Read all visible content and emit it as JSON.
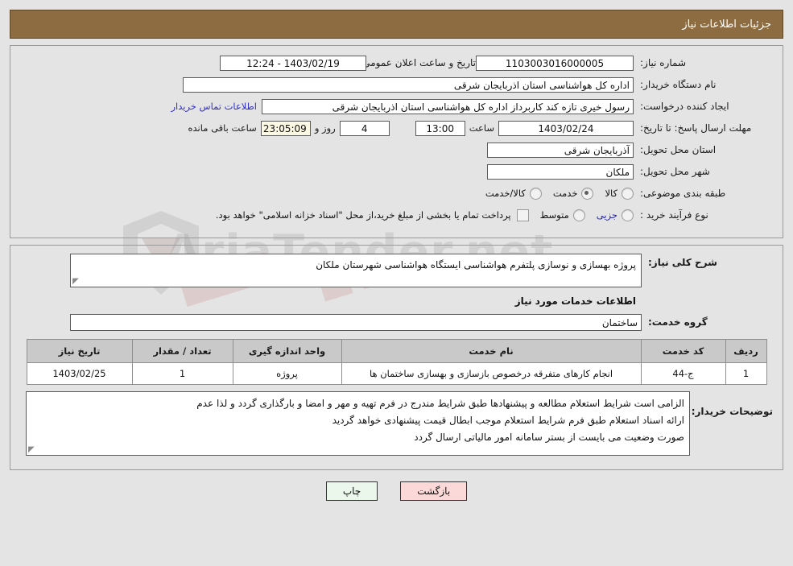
{
  "header": {
    "title": "جزئیات اطلاعات نیاز"
  },
  "colors": {
    "header_bg": "#8d6c42",
    "header_text": "#ffffff",
    "link": "#3030c8",
    "page_bg": "#e4e4e4",
    "table_header_bg": "#c9c9c9",
    "highlight_field_bg": "#fbf8e3",
    "print_btn_bg": "#eaf7ea",
    "back_btn_bg": "#fbd9d9"
  },
  "watermark": {
    "text": "AriaTender.net"
  },
  "form": {
    "need_number": {
      "label": "شماره نیاز:",
      "value": "1103003016000005"
    },
    "announce_datetime": {
      "label": "تاریخ و ساعت اعلان عمومی:",
      "value": "1403/02/19 - 12:24"
    },
    "buyer_org": {
      "label": "نام دستگاه خریدار:",
      "value": "اداره کل هواشناسی استان اذربایجان شرقی"
    },
    "buyer_org_second": {
      "value": ""
    },
    "requester": {
      "label": "ایجاد کننده درخواست:",
      "value": "رسول خیری تازه کند کاربرداز اداره کل هواشناسی استان اذربایجان شرقی"
    },
    "buyer_contact_link": {
      "label": "اطلاعات تماس خریدار"
    },
    "deadline": {
      "label": "مهلت ارسال پاسخ: تا تاریخ:",
      "date": "1403/02/24",
      "time_label": "ساعت",
      "time": "13:00",
      "days": "4",
      "days_label": "روز و",
      "countdown": "23:05:09",
      "countdown_label": "ساعت باقی مانده"
    },
    "delivery_province": {
      "label": "استان محل تحویل:",
      "value": "آذربایجان شرقی"
    },
    "delivery_city": {
      "label": "شهر محل تحویل:",
      "value": "ملکان"
    },
    "classification": {
      "label": "طبقه بندی موضوعی:",
      "options": [
        {
          "label": "کالا",
          "selected": false
        },
        {
          "label": "خدمت",
          "selected": true
        },
        {
          "label": "کالا/خدمت",
          "selected": false
        }
      ]
    },
    "purchase_process": {
      "label": "نوع فرآیند خرید :",
      "options": [
        {
          "label": "جزیی",
          "selected": false,
          "highlight": true
        },
        {
          "label": "متوسط",
          "selected": false,
          "highlight": false
        }
      ],
      "checkbox_label": "پرداخت تمام یا بخشی از مبلغ خرید،از محل \"اسناد خزانه اسلامی\" خواهد بود.",
      "checkbox_checked": false
    }
  },
  "description": {
    "label": "شرح کلی نیاز:",
    "value": "پروژه بهسازی و نوسازی پلتفرم هواشناسی ایستگاه هواشناسی شهرستان ملکان"
  },
  "services_section": {
    "heading": "اطلاعات خدمات مورد نیاز",
    "service_group": {
      "label": "گروه خدمت:",
      "value": "ساختمان"
    },
    "table": {
      "columns": [
        "ردیف",
        "کد خدمت",
        "نام خدمت",
        "واحد اندازه گیری",
        "تعداد / مقدار",
        "تاریخ نیاز"
      ],
      "rows": [
        {
          "row_no": "1",
          "service_code": "ج-44",
          "service_name": "انجام کارهای متفرقه درخصوص بازسازی و بهسازی ساختمان ها",
          "unit": "پروژه",
          "quantity": "1",
          "need_date": "1403/02/25"
        }
      ]
    }
  },
  "buyer_notes": {
    "label": "توضیحات خریدار:",
    "lines": [
      "الزامی است شرایط استعلام مطالعه و پیشنهادها طبق شرایط مندرج در فرم تهیه و مهر و امضا و بارگذاری گردد و لذا عدم",
      "ارائه اسناد استعلام طبق فرم شرایط استعلام موجب ابطال قیمت پیشنهادی خواهد گردید",
      "صورت وضعیت می بایست از بستر سامانه امور مالیاتی ارسال گردد"
    ]
  },
  "footer": {
    "print_label": "چاپ",
    "back_label": "بازگشت"
  }
}
